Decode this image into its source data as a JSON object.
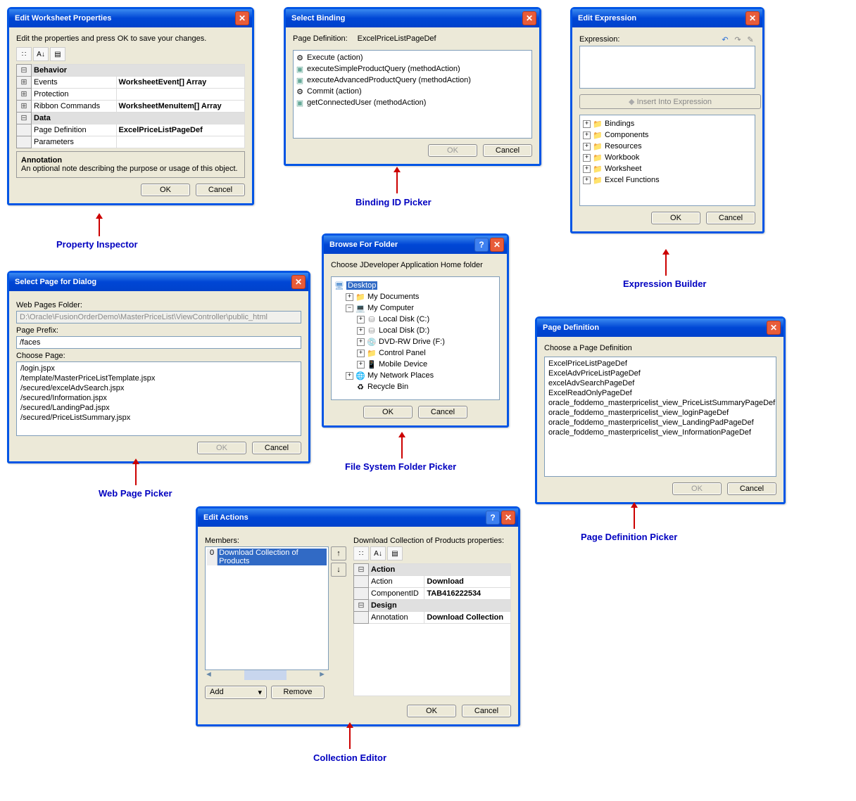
{
  "shared": {
    "ok": "OK",
    "cancel": "Cancel",
    "add": "Add",
    "remove": "Remove"
  },
  "propInspector": {
    "title": "Edit Worksheet Properties",
    "instruction": "Edit the properties and press OK to save your changes.",
    "sections": [
      {
        "name": "Behavior",
        "rows": [
          {
            "label": "Events",
            "value": "WorksheetEvent[] Array"
          },
          {
            "label": "Protection",
            "value": ""
          },
          {
            "label": "Ribbon Commands",
            "value": "WorksheetMenuItem[] Array"
          }
        ]
      },
      {
        "name": "Data",
        "rows": [
          {
            "label": "Page Definition",
            "value": "ExcelPriceListPageDef"
          },
          {
            "label": "Parameters",
            "value": ""
          }
        ]
      }
    ],
    "annotation": {
      "title": "Annotation",
      "text": "An optional note describing the purpose or usage of this object."
    },
    "caption": "Property Inspector"
  },
  "bindingPicker": {
    "title": "Select Binding",
    "pageDefLabel": "Page Definition:",
    "pageDefValue": "ExcelPriceListPageDef",
    "items": [
      {
        "name": "Execute (action)",
        "icon": "action"
      },
      {
        "name": "executeSimpleProductQuery  (methodAction)",
        "icon": "method"
      },
      {
        "name": "executeAdvancedProductQuery  (methodAction)",
        "icon": "method"
      },
      {
        "name": "Commit (action)",
        "icon": "action"
      },
      {
        "name": "getConnectedUser (methodAction)",
        "icon": "method"
      }
    ],
    "caption": "Binding ID Picker"
  },
  "exprBuilder": {
    "title": "Edit Expression",
    "label": "Expression:",
    "insertLabel": "Insert Into Expression",
    "treeItems": [
      "Bindings",
      "Components",
      "Resources",
      "Workbook",
      "Worksheet",
      "Excel Functions"
    ],
    "caption": "Expression Builder"
  },
  "webPagePicker": {
    "title": "Select Page for Dialog",
    "folderLabel": "Web Pages Folder:",
    "folderValue": "D:\\Oracle\\FusionOrderDemo\\MasterPriceList\\ViewController\\public_html",
    "prefixLabel": "Page Prefix:",
    "prefixValue": "/faces",
    "chooseLabel": "Choose Page:",
    "pages": [
      "/login.jspx",
      "/template/MasterPriceListTemplate.jspx",
      "/secured/excelAdvSearch.jspx",
      "/secured/Information.jspx",
      "/secured/LandingPad.jspx",
      "/secured/PriceListSummary.jspx"
    ],
    "caption": "Web Page Picker"
  },
  "folderPicker": {
    "title": "Browse For Folder",
    "instruction": "Choose JDeveloper Application Home folder",
    "tree": {
      "root": "Desktop",
      "items": [
        {
          "indent": 1,
          "pm": "+",
          "icon": "folder",
          "label": "My Documents"
        },
        {
          "indent": 1,
          "pm": "-",
          "icon": "computer",
          "label": "My Computer"
        },
        {
          "indent": 2,
          "pm": "+",
          "icon": "disk",
          "label": "Local Disk (C:)"
        },
        {
          "indent": 2,
          "pm": "+",
          "icon": "disk",
          "label": "Local Disk (D:)"
        },
        {
          "indent": 2,
          "pm": "+",
          "icon": "dvd",
          "label": "DVD-RW Drive (F:)"
        },
        {
          "indent": 2,
          "pm": "+",
          "icon": "ctrl",
          "label": "Control Panel"
        },
        {
          "indent": 2,
          "pm": "+",
          "icon": "mobile",
          "label": "Mobile Device"
        },
        {
          "indent": 1,
          "pm": "+",
          "icon": "net",
          "label": "My Network Places"
        },
        {
          "indent": 1,
          "pm": "",
          "icon": "recycle",
          "label": "Recycle Bin"
        }
      ]
    },
    "caption": "File System Folder Picker"
  },
  "pageDefPicker": {
    "title": "Page Definition",
    "instruction": "Choose a Page Definition",
    "items": [
      "ExcelPriceListPageDef",
      "ExcelAdvPriceListPageDef",
      "excelAdvSearchPageDef",
      "ExcelReadOnlyPageDef",
      "oracle_foddemo_masterpricelist_view_PriceListSummaryPageDef",
      "oracle_foddemo_masterpricelist_view_loginPageDef",
      "oracle_foddemo_masterpricelist_view_LandingPadPageDef",
      "oracle_foddemo_masterpricelist_view_InformationPageDef"
    ],
    "caption": "Page Definition Picker"
  },
  "collectionEditor": {
    "title": "Edit Actions",
    "membersLabel": "Members:",
    "selectedMember": "Download Collection of Products",
    "memberIndex": "0",
    "propsLabel": "Download Collection of Products properties:",
    "sections": [
      {
        "name": "Action",
        "rows": [
          {
            "label": "Action",
            "value": "Download"
          },
          {
            "label": "ComponentID",
            "value": "TAB416222534"
          }
        ]
      },
      {
        "name": "Design",
        "rows": [
          {
            "label": "Annotation",
            "value": "Download Collection"
          }
        ]
      }
    ],
    "caption": "Collection Editor"
  }
}
